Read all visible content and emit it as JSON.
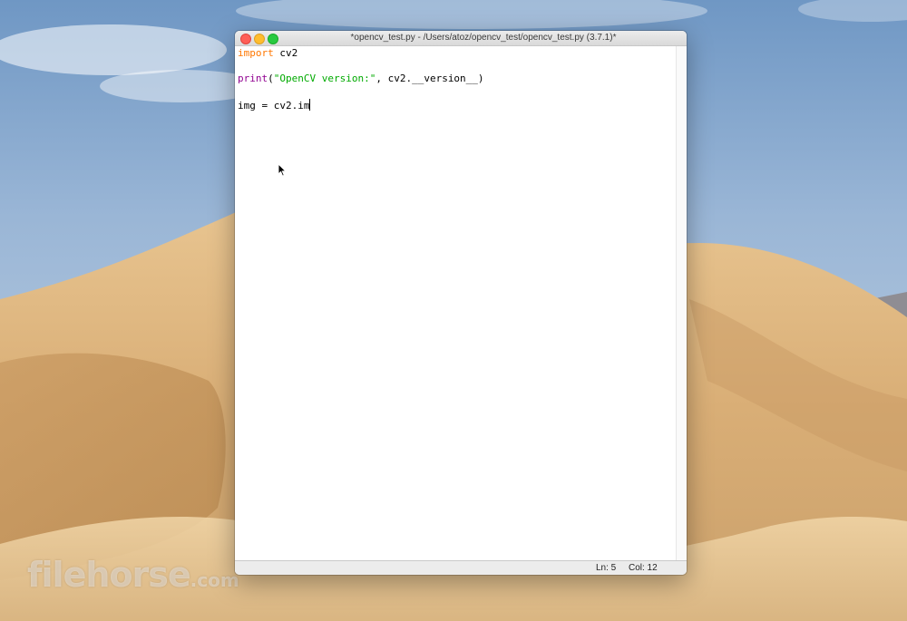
{
  "window": {
    "title": "*opencv_test.py - /Users/atoz/opencv_test/opencv_test.py (3.7.1)*"
  },
  "editor": {
    "line1": {
      "keyword": "import",
      "rest": " cv2"
    },
    "line3": {
      "builtin": "print",
      "open": "(",
      "string": "\"OpenCV version:\"",
      "rest": ", cv2.__version__)"
    },
    "line5": {
      "text": "img = cv2.im"
    }
  },
  "status": {
    "line": "Ln: 5",
    "col": "Col: 12"
  },
  "watermark": {
    "brand": "filehorse",
    "suffix": ".com"
  },
  "icons": {
    "close": "close-button-red",
    "minimize": "minimize-button-yellow",
    "maximize": "zoom-button-green",
    "cursor": "arrow-pointer-icon"
  },
  "colors": {
    "keyword": "#ff7700",
    "builtin": "#900090",
    "string": "#00aa00",
    "close": "#ff5f57",
    "minimize": "#ffbd2e",
    "maximize": "#28c940"
  }
}
